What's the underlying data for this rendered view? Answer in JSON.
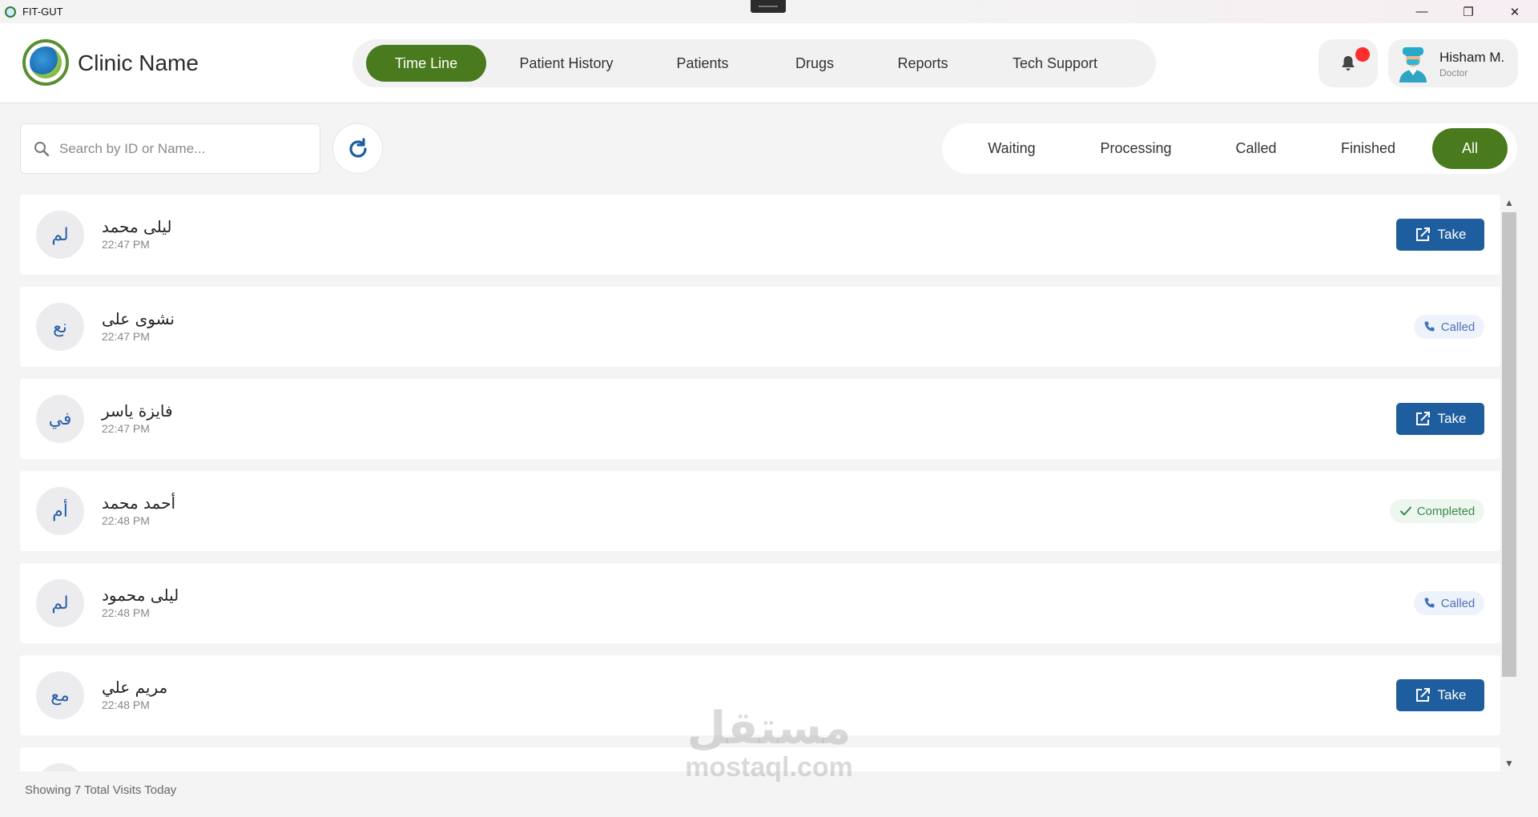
{
  "window": {
    "title": "FIT-GUT",
    "minimize": "—",
    "restore": "❐",
    "close": "✕"
  },
  "header": {
    "clinic_name": "Clinic Name",
    "nav": [
      {
        "label": "Time Line",
        "active": true
      },
      {
        "label": "Patient History",
        "active": false
      },
      {
        "label": "Patients",
        "active": false
      },
      {
        "label": "Drugs",
        "active": false
      },
      {
        "label": "Reports",
        "active": false
      },
      {
        "label": "Tech Support",
        "active": false
      }
    ],
    "user": {
      "name": "Hisham M.",
      "role": "Doctor"
    }
  },
  "toolbar": {
    "search_placeholder": "Search by ID or Name...",
    "filters": [
      {
        "label": "Waiting",
        "active": false
      },
      {
        "label": "Processing",
        "active": false
      },
      {
        "label": "Called",
        "active": false
      },
      {
        "label": "Finished",
        "active": false
      },
      {
        "label": "All",
        "active": true
      }
    ]
  },
  "visits": [
    {
      "initials": "لم",
      "name": "ليلى محمد",
      "time": "22:47 PM",
      "action": "take",
      "label": "Take"
    },
    {
      "initials": "نع",
      "name": "نشوى على",
      "time": "22:47 PM",
      "action": "called",
      "label": "Called"
    },
    {
      "initials": "في",
      "name": "فايزة ياسر",
      "time": "22:47 PM",
      "action": "take",
      "label": "Take"
    },
    {
      "initials": "أم",
      "name": "أحمد محمد",
      "time": "22:48 PM",
      "action": "completed",
      "label": "Completed"
    },
    {
      "initials": "لم",
      "name": "ليلى محمود",
      "time": "22:48 PM",
      "action": "called",
      "label": "Called"
    },
    {
      "initials": "مع",
      "name": "مريم علي",
      "time": "22:48 PM",
      "action": "take",
      "label": "Take"
    }
  ],
  "footer": {
    "summary": "Showing 7 Total Visits Today"
  },
  "watermark": {
    "arabic": "مستقل",
    "latin": "mostaql.com"
  },
  "colors": {
    "primary_green": "#4a7a1e",
    "take_blue": "#1f5e9e",
    "notification_red": "#ff2d2d"
  },
  "icons": {
    "search": "search-icon",
    "refresh": "refresh-icon",
    "bell": "bell-icon",
    "take": "external-edit-icon",
    "called": "phone-icon",
    "completed": "check-icon"
  }
}
